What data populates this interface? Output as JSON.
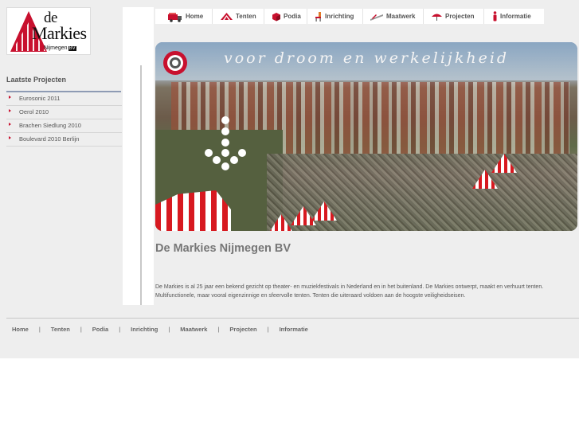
{
  "logo": {
    "line1": "de",
    "line2": "Markies",
    "line3": "Nijmegen",
    "bv": "BV"
  },
  "top_nav": [
    {
      "label": "Home",
      "icon": "truck-icon"
    },
    {
      "label": "Tenten",
      "icon": "tent-icon"
    },
    {
      "label": "Podia",
      "icon": "stage-icon"
    },
    {
      "label": "Inrichting",
      "icon": "chair-icon"
    },
    {
      "label": "Maatwerk",
      "icon": "ruler-icon"
    },
    {
      "label": "Projecten",
      "icon": "umbrella-icon"
    },
    {
      "label": "Informatie",
      "icon": "info-icon"
    }
  ],
  "banner": {
    "slogan": "voor droom en werkelijkheid"
  },
  "sidebar": {
    "heading": "Laatste Projecten",
    "items": [
      "Eurosonic 2011",
      "Oerol 2010",
      "Brachen Siedlung 2010",
      "Boulevard 2010 Berlijn"
    ]
  },
  "main": {
    "title": "De Markies Nijmegen BV",
    "intro": "De Markies is al 25 jaar een bekend gezicht op theater- en muziekfestivals in Nederland en in het buitenland. De Markies ontwerpt, maakt en verhuurt tenten. Multifunctionele, maar vooral eigenzinnige en sfeervolle tenten. Tenten die uiteraard voldoen aan de hoogste veiligheidseisen."
  },
  "footer_nav": {
    "items": [
      "Home",
      "Tenten",
      "Podia",
      "Inrichting",
      "Maatwerk",
      "Projecten",
      "Informatie"
    ],
    "separator": "|"
  },
  "colors": {
    "accent": "#c8102e",
    "background": "#eeeeee",
    "text": "#555555",
    "title": "#777777"
  }
}
